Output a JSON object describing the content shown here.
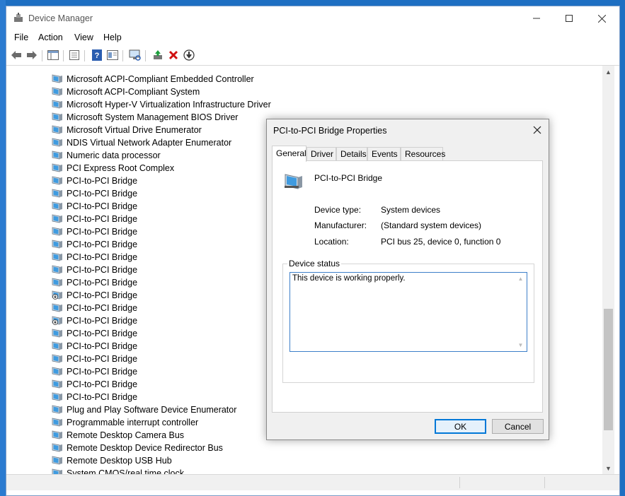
{
  "window": {
    "title": "Device Manager"
  },
  "menu": [
    "File",
    "Action",
    "View",
    "Help"
  ],
  "toolbar": {
    "buttons": [
      "back-arrow-icon",
      "forward-arrow-icon",
      "show-hide-tree-icon",
      "properties-icon",
      "help-icon",
      "view-icon",
      "scan-hardware-icon",
      "update-driver-icon",
      "uninstall-icon",
      "disable-icon"
    ]
  },
  "tree": {
    "items": [
      "Microsoft ACPI-Compliant Embedded Controller",
      "Microsoft ACPI-Compliant System",
      "Microsoft Hyper-V Virtualization Infrastructure Driver",
      "Microsoft System Management BIOS Driver",
      "Microsoft Virtual Drive Enumerator",
      "NDIS Virtual Network Adapter Enumerator",
      "Numeric data processor",
      "PCI Express Root Complex",
      "PCI-to-PCI Bridge",
      "PCI-to-PCI Bridge",
      "PCI-to-PCI Bridge",
      "PCI-to-PCI Bridge",
      "PCI-to-PCI Bridge",
      "PCI-to-PCI Bridge",
      "PCI-to-PCI Bridge",
      "PCI-to-PCI Bridge",
      "PCI-to-PCI Bridge",
      "PCI-to-PCI Bridge",
      "PCI-to-PCI Bridge",
      "PCI-to-PCI Bridge",
      "PCI-to-PCI Bridge",
      "PCI-to-PCI Bridge",
      "PCI-to-PCI Bridge",
      "PCI-to-PCI Bridge",
      "PCI-to-PCI Bridge",
      "PCI-to-PCI Bridge",
      "Plug and Play Software Device Enumerator",
      "Programmable interrupt controller",
      "Remote Desktop Camera Bus",
      "Remote Desktop Device Redirector Bus",
      "Remote Desktop USB Hub",
      "System CMOS/real time clock"
    ],
    "disabled_indices": [
      17,
      19
    ]
  },
  "dialog": {
    "title": "PCI-to-PCI Bridge Properties",
    "tabs": [
      "General",
      "Driver",
      "Details",
      "Events",
      "Resources"
    ],
    "active_tab": "General",
    "device_name": "PCI-to-PCI Bridge",
    "props": {
      "device_type_label": "Device type:",
      "device_type": "System devices",
      "manufacturer_label": "Manufacturer:",
      "manufacturer": "(Standard system devices)",
      "location_label": "Location:",
      "location": "PCI bus 25, device 0, function 0"
    },
    "status_group_title": "Device status",
    "status_text": "This device is working properly.",
    "ok_label": "OK",
    "cancel_label": "Cancel"
  },
  "colors": {
    "accent": "#0078d7",
    "desktop": "#1e6fc2",
    "delete_red": "#d01010"
  }
}
